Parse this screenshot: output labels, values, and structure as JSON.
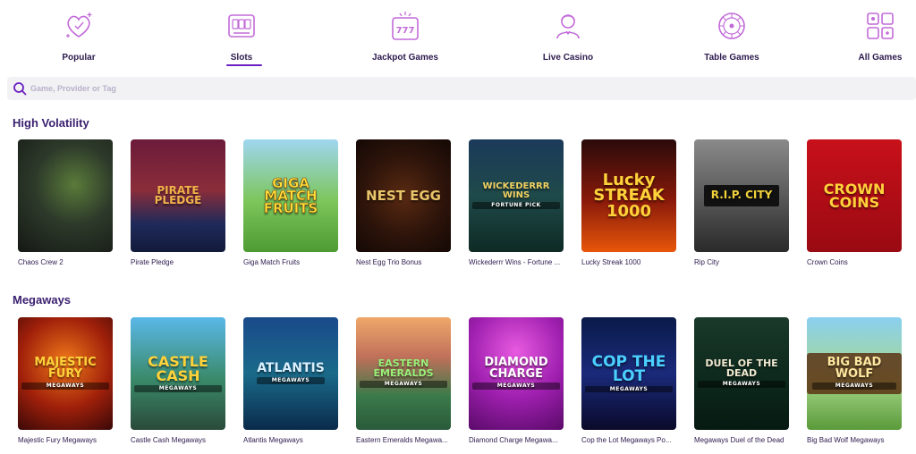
{
  "nav": [
    {
      "label": "Popular",
      "icon": "heart-sparkle-icon"
    },
    {
      "label": "Slots",
      "icon": "slot-machine-icon",
      "active": true
    },
    {
      "label": "Jackpot Games",
      "icon": "jackpot-777-icon"
    },
    {
      "label": "Live Casino",
      "icon": "live-dealer-icon"
    },
    {
      "label": "Table Games",
      "icon": "roulette-wheel-icon"
    },
    {
      "label": "All Games",
      "icon": "all-games-grid-icon"
    }
  ],
  "colors": {
    "accent": "#6a1fc2",
    "icon": "#c26ad9",
    "heading": "#3b2170",
    "search_bg": "#f2f2f4"
  },
  "search": {
    "placeholder": "Game, Provider or Tag",
    "value": ""
  },
  "sections": [
    {
      "title": "High Volatility",
      "games": [
        {
          "name": "Chaos Crew 2",
          "art": "",
          "art_sub": ""
        },
        {
          "name": "Pirate Pledge",
          "art": "PIRATE PLEDGE",
          "art_sub": ""
        },
        {
          "name": "Giga Match Fruits",
          "art": "GIGA MATCH FRUITS",
          "art_sub": ""
        },
        {
          "name": "Nest Egg Trio Bonus",
          "art": "NEST EGG",
          "art_sub": ""
        },
        {
          "name": "Wickederrr Wins - Fortune ...",
          "art": "WICKEDERRR WINS",
          "art_sub": "FORTUNE PICK"
        },
        {
          "name": "Lucky Streak 1000",
          "art": "Lucky STREAK 1000",
          "art_sub": ""
        },
        {
          "name": "Rip City",
          "art": "R.I.P. CITY",
          "art_sub": ""
        },
        {
          "name": "Crown Coins",
          "art": "CROWN COINS",
          "art_sub": ""
        }
      ]
    },
    {
      "title": "Megaways",
      "games": [
        {
          "name": "Majestic Fury Megaways",
          "art": "MAJESTIC FURY",
          "art_sub": "MEGAWAYS"
        },
        {
          "name": "Castle Cash Megaways",
          "art": "CASTLE CASH",
          "art_sub": "MEGAWAYS"
        },
        {
          "name": "Atlantis Megaways",
          "art": "ATLANTIS",
          "art_sub": "MEGAWAYS"
        },
        {
          "name": "Eastern Emeralds Megawa...",
          "art": "EASTERN EMERALDS",
          "art_sub": "MEGAWAYS"
        },
        {
          "name": "Diamond Charge Megawa...",
          "art": "DIAMOND CHARGE",
          "art_sub": "MEGAWAYS"
        },
        {
          "name": "Cop the Lot Megaways Po...",
          "art": "COP THE LOT",
          "art_sub": "MEGAWAYS"
        },
        {
          "name": "Megaways Duel of the Dead",
          "art": "DUEL OF THE DEAD",
          "art_sub": "MEGAWAYS"
        },
        {
          "name": "Big Bad Wolf Megaways",
          "art": "BIG BAD WOLF",
          "art_sub": "MEGAWAYS"
        }
      ]
    }
  ]
}
